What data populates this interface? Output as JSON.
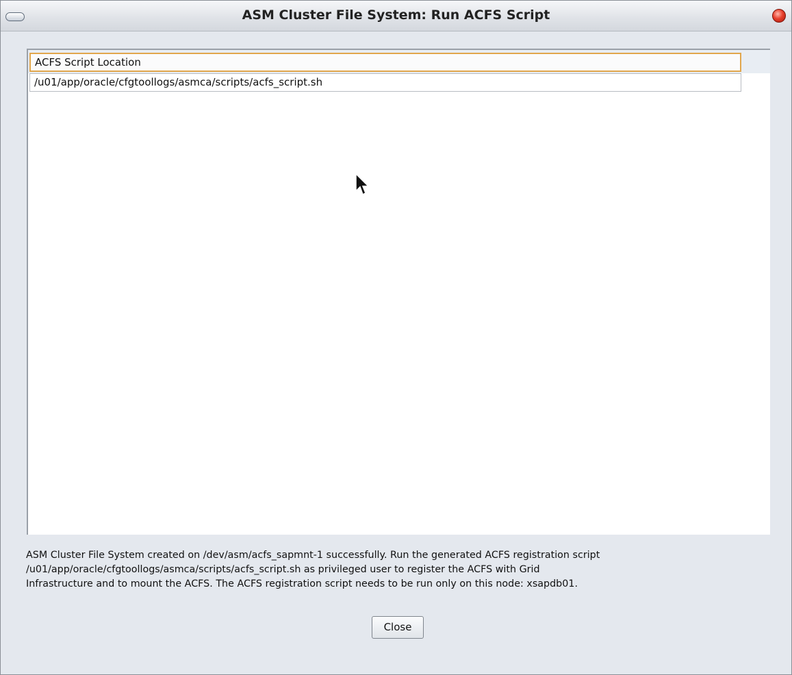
{
  "window": {
    "title": "ASM Cluster File System: Run ACFS Script"
  },
  "table": {
    "header": "ACFS Script Location",
    "rows": [
      {
        "location": "/u01/app/oracle/cfgtoollogs/asmca/scripts/acfs_script.sh"
      }
    ]
  },
  "message": {
    "line1": "ASM Cluster File System created on /dev/asm/acfs_sapmnt-1 successfully. Run the generated ACFS registration script",
    "line2": "/u01/app/oracle/cfgtoollogs/asmca/scripts/acfs_script.sh as privileged user to register the ACFS with Grid",
    "line3": "Infrastructure and to mount the ACFS. The ACFS registration script needs to be run only on this node: xsapdb01."
  },
  "buttons": {
    "close_label": "Close"
  },
  "icons": {
    "window_menu": "window-menu-icon",
    "window_close": "window-close-icon",
    "cursor": "mouse-pointer-icon"
  },
  "colors": {
    "header_focus_border": "#e1a64c",
    "close_button_red": "#e8402d"
  }
}
